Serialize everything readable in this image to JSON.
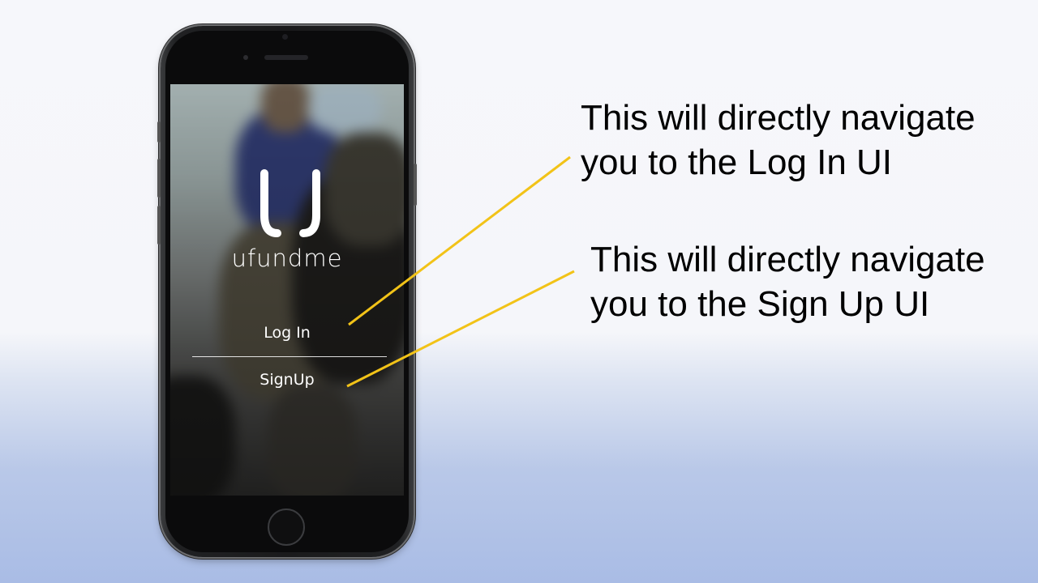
{
  "app": {
    "brand_name": "ufundme",
    "logo_icon": "u-logo-icon",
    "login_label": "Log In",
    "signup_label": "SignUp"
  },
  "annotations": {
    "login_line1": "This will directly navigate",
    "login_line2": "you to the Log In UI",
    "signup_line1": "This will directly navigate",
    "signup_line2": "you to the Sign Up UI"
  },
  "colors": {
    "callout_line": "#f2c318",
    "brand_text": "#ffffff",
    "annotation_text": "#000000"
  }
}
